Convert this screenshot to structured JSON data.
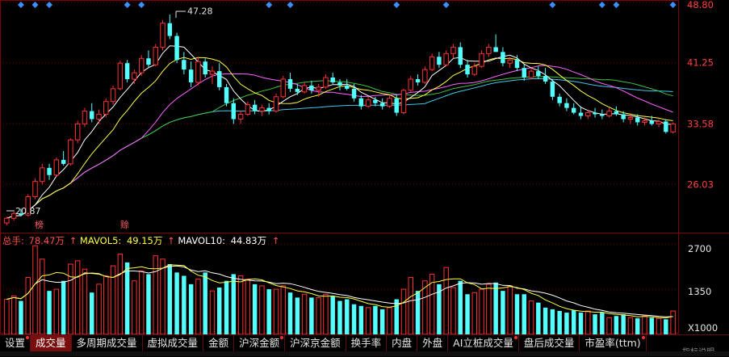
{
  "markers": {
    "color": "#3b8fff",
    "positions_count": 13
  },
  "price_axis": {
    "ticks": [
      "48.80",
      "41.25",
      "33.58",
      "26.03"
    ],
    "ylim": [
      20,
      48.8
    ],
    "color": "#ff4040"
  },
  "annotations": {
    "high_label": "47.28",
    "low_label": "20.87",
    "tag_1": "榜",
    "tag_2": "赊"
  },
  "volume_legend": {
    "total_label": "总手:",
    "total_value": "78.47万",
    "ma5_label": "MAVOL5:",
    "ma5_value": "49.15万",
    "ma10_label": "MAVOL10:",
    "ma10_value": "44.83万",
    "arrow": "↑"
  },
  "volume_axis": {
    "ticks": [
      "2700",
      "1350"
    ],
    "unit": "X1000",
    "ylim": [
      0,
      2800
    ]
  },
  "tabs": [
    {
      "label": "设置",
      "dot": true,
      "active": false
    },
    {
      "label": "成交量",
      "dot": false,
      "active": true
    },
    {
      "label": "多周期成交量",
      "dot": false,
      "active": false
    },
    {
      "label": "虚拟成交量",
      "dot": false,
      "active": false
    },
    {
      "label": "金额",
      "dot": false,
      "active": false
    },
    {
      "label": "沪深金额",
      "dot": true,
      "active": false
    },
    {
      "label": "沪深京金额",
      "dot": false,
      "active": false
    },
    {
      "label": "换手率",
      "dot": false,
      "active": false
    },
    {
      "label": "内盘",
      "dot": false,
      "active": false
    },
    {
      "label": "外盘",
      "dot": false,
      "active": false
    },
    {
      "label": "AI立桩成交量",
      "dot": true,
      "active": false
    },
    {
      "label": "盘后成交量",
      "dot": false,
      "active": false
    },
    {
      "label": "市盈率(ttm)",
      "dot": true,
      "active": false
    }
  ],
  "help_fragment": "指标说明",
  "colors": {
    "up": "#ff3030",
    "down": "#54ffff",
    "ma5": "#ffffff",
    "ma10": "#ffff40",
    "ma20": "#ff60ff",
    "ma30": "#40c040",
    "ma60": "#40c8e8",
    "grid": "#800000"
  },
  "chart_data": {
    "type": "candlestick",
    "candles": [
      [
        21.2,
        22.0,
        20.9,
        21.8
      ],
      [
        21.8,
        22.6,
        21.5,
        22.4
      ],
      [
        22.4,
        23.0,
        22.0,
        22.2
      ],
      [
        22.2,
        24.8,
        22.0,
        24.5
      ],
      [
        24.5,
        26.8,
        24.2,
        26.4
      ],
      [
        26.4,
        28.6,
        26.0,
        28.1
      ],
      [
        28.1,
        28.6,
        26.6,
        27.2
      ],
      [
        27.2,
        29.4,
        27.0,
        29.1
      ],
      [
        29.1,
        30.2,
        28.4,
        28.6
      ],
      [
        28.6,
        31.8,
        28.4,
        31.6
      ],
      [
        31.6,
        34.0,
        31.2,
        33.6
      ],
      [
        33.6,
        35.6,
        33.2,
        35.2
      ],
      [
        35.2,
        36.2,
        33.8,
        34.2
      ],
      [
        34.2,
        35.4,
        33.6,
        34.8
      ],
      [
        34.8,
        36.8,
        34.4,
        36.4
      ],
      [
        36.4,
        38.4,
        36.0,
        38.0
      ],
      [
        38.0,
        41.5,
        37.8,
        41.2
      ],
      [
        41.2,
        41.6,
        38.8,
        39.2
      ],
      [
        39.2,
        40.4,
        38.6,
        40.0
      ],
      [
        40.0,
        42.2,
        39.6,
        41.8
      ],
      [
        41.8,
        42.8,
        40.6,
        41.0
      ],
      [
        41.0,
        43.6,
        40.8,
        43.2
      ],
      [
        43.2,
        46.6,
        42.8,
        46.2
      ],
      [
        46.2,
        47.28,
        44.2,
        44.6
      ],
      [
        44.6,
        45.0,
        41.2,
        41.6
      ],
      [
        41.6,
        42.6,
        39.8,
        40.4
      ],
      [
        40.4,
        41.4,
        38.2,
        38.8
      ],
      [
        38.8,
        42.0,
        38.4,
        41.4
      ],
      [
        41.4,
        41.8,
        39.4,
        39.8
      ],
      [
        39.8,
        40.8,
        38.6,
        40.2
      ],
      [
        40.2,
        41.2,
        37.8,
        38.2
      ],
      [
        38.2,
        38.6,
        35.8,
        36.2
      ],
      [
        36.2,
        36.8,
        33.6,
        34.2
      ],
      [
        34.2,
        35.2,
        33.6,
        34.8
      ],
      [
        34.8,
        36.4,
        34.6,
        36.0
      ],
      [
        36.0,
        36.6,
        34.8,
        35.2
      ],
      [
        35.2,
        36.0,
        34.6,
        35.6
      ],
      [
        35.6,
        36.2,
        34.8,
        35.2
      ],
      [
        35.2,
        37.4,
        35.0,
        37.0
      ],
      [
        37.0,
        39.6,
        36.8,
        39.2
      ],
      [
        39.2,
        40.0,
        37.6,
        38.0
      ],
      [
        38.0,
        38.6,
        37.2,
        37.6
      ],
      [
        37.6,
        38.8,
        37.4,
        38.4
      ],
      [
        38.4,
        39.0,
        37.4,
        37.8
      ],
      [
        37.8,
        38.6,
        37.0,
        38.2
      ],
      [
        38.2,
        39.8,
        38.0,
        39.4
      ],
      [
        39.4,
        40.0,
        38.6,
        38.8
      ],
      [
        38.8,
        39.2,
        37.8,
        38.4
      ],
      [
        38.4,
        39.2,
        37.8,
        38.0
      ],
      [
        38.0,
        38.6,
        36.4,
        36.8
      ],
      [
        36.8,
        37.2,
        35.4,
        35.8
      ],
      [
        35.8,
        37.0,
        35.6,
        36.6
      ],
      [
        36.6,
        37.0,
        35.8,
        36.2
      ],
      [
        36.2,
        36.8,
        35.4,
        35.8
      ],
      [
        35.8,
        37.2,
        35.6,
        36.8
      ],
      [
        36.8,
        37.2,
        34.6,
        35.0
      ],
      [
        35.0,
        38.0,
        34.8,
        37.8
      ],
      [
        37.8,
        39.6,
        37.6,
        39.2
      ],
      [
        39.2,
        39.8,
        38.4,
        38.8
      ],
      [
        38.8,
        40.8,
        38.6,
        40.4
      ],
      [
        40.4,
        42.4,
        40.2,
        42.0
      ],
      [
        42.0,
        42.6,
        40.6,
        41.0
      ],
      [
        41.0,
        42.8,
        40.8,
        42.4
      ],
      [
        42.4,
        43.6,
        41.8,
        43.2
      ],
      [
        43.2,
        43.8,
        40.6,
        41.0
      ],
      [
        41.0,
        41.6,
        39.4,
        39.8
      ],
      [
        39.8,
        41.2,
        39.6,
        40.8
      ],
      [
        40.8,
        42.8,
        40.6,
        42.4
      ],
      [
        42.4,
        43.6,
        42.0,
        43.2
      ],
      [
        43.2,
        44.8,
        42.8,
        42.6
      ],
      [
        42.6,
        43.2,
        40.8,
        41.2
      ],
      [
        41.2,
        42.0,
        40.6,
        41.6
      ],
      [
        41.6,
        42.2,
        40.2,
        40.6
      ],
      [
        40.6,
        41.0,
        39.0,
        39.4
      ],
      [
        39.4,
        40.6,
        39.2,
        40.2
      ],
      [
        40.2,
        40.8,
        39.2,
        39.6
      ],
      [
        39.6,
        40.6,
        38.6,
        38.9
      ],
      [
        38.9,
        39.2,
        36.6,
        37.0
      ],
      [
        37.0,
        37.4,
        35.8,
        36.2
      ],
      [
        36.2,
        36.8,
        35.2,
        35.6
      ],
      [
        35.6,
        36.2,
        34.8,
        35.0
      ],
      [
        35.0,
        35.8,
        34.2,
        34.6
      ],
      [
        34.6,
        35.4,
        34.2,
        35.0
      ],
      [
        35.0,
        35.6,
        34.4,
        34.8
      ],
      [
        34.8,
        35.4,
        34.2,
        34.6
      ],
      [
        34.6,
        35.6,
        34.4,
        35.2
      ],
      [
        35.2,
        35.8,
        34.6,
        34.8
      ],
      [
        34.8,
        35.2,
        33.8,
        34.2
      ],
      [
        34.2,
        34.8,
        33.6,
        34.4
      ],
      [
        34.4,
        34.8,
        33.4,
        33.8
      ],
      [
        33.8,
        34.4,
        33.4,
        34.0
      ],
      [
        34.0,
        34.6,
        33.4,
        33.6
      ],
      [
        33.6,
        34.2,
        33.2,
        33.9
      ],
      [
        33.9,
        34.2,
        32.4,
        32.6
      ],
      [
        32.6,
        33.8,
        32.4,
        33.6
      ]
    ],
    "volume": [
      1050,
      1150,
      1000,
      1700,
      2650,
      2250,
      1300,
      1350,
      1600,
      2100,
      2200,
      1950,
      1250,
      1500,
      1750,
      2050,
      2400,
      2150,
      1600,
      1900,
      1800,
      2350,
      2250,
      2100,
      1850,
      1750,
      1500,
      1650,
      1850,
      1300,
      1400,
      1600,
      1800,
      1750,
      1650,
      1500,
      1450,
      1350,
      1350,
      1450,
      1250,
      1100,
      1200,
      1100,
      1100,
      1200,
      1150,
      1000,
      1050,
      900,
      850,
      800,
      850,
      750,
      800,
      1050,
      1350,
      1700,
      1300,
      1600,
      1800,
      1500,
      2000,
      1400,
      1600,
      1200,
      1250,
      1350,
      1500,
      1550,
      1300,
      1450,
      1200,
      1200,
      1000,
      950,
      800,
      750,
      700,
      650,
      720,
      650,
      700,
      600,
      650,
      500,
      550,
      600,
      500,
      480,
      550,
      500,
      480,
      450,
      700
    ]
  }
}
